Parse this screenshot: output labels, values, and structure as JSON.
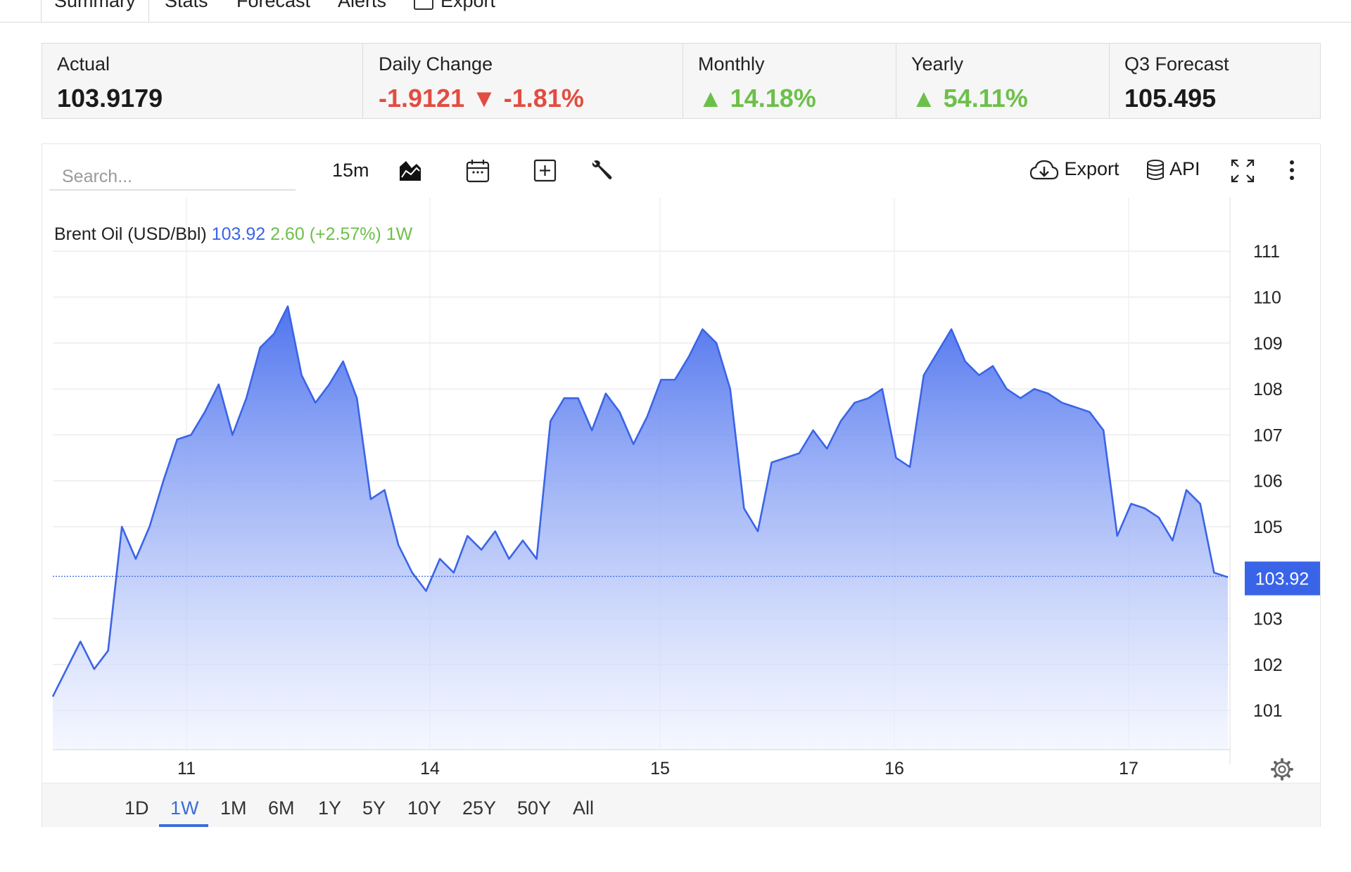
{
  "tabs": [
    {
      "label": "Summary",
      "active": true
    },
    {
      "label": "Stats"
    },
    {
      "label": "Forecast"
    },
    {
      "label": "Alerts"
    },
    {
      "label": "Export",
      "icon": "export-icon"
    }
  ],
  "stats": {
    "actual": {
      "label": "Actual",
      "value": "103.9179"
    },
    "daily": {
      "label": "Daily Change",
      "value": "-1.9121",
      "arrow": "▼",
      "pct": "-1.81%"
    },
    "monthly": {
      "label": "Monthly",
      "arrow": "▲",
      "pct": "14.18%"
    },
    "yearly": {
      "label": "Yearly",
      "arrow": "▲",
      "pct": "54.11%"
    },
    "forecast": {
      "label": "Q3 Forecast",
      "value": "105.495"
    }
  },
  "toolbar": {
    "search_placeholder": "Search...",
    "interval": "15m",
    "export_label": "Export",
    "api_label": "API"
  },
  "legend": {
    "name": "Brent Oil (USD/Bbl)",
    "last": "103.92",
    "change": "2.60 (+2.57%)",
    "period": "1W"
  },
  "price_tag": "103.92",
  "ranges": [
    {
      "label": "1D"
    },
    {
      "label": "1W",
      "active": true
    },
    {
      "label": "1M"
    },
    {
      "label": "6M"
    },
    {
      "label": "1Y"
    },
    {
      "label": "5Y"
    },
    {
      "label": "10Y"
    },
    {
      "label": "25Y"
    },
    {
      "label": "50Y"
    },
    {
      "label": "All"
    }
  ],
  "colors": {
    "line": "#3a64e8",
    "fill_top": "#4f74ee",
    "fill_bottom": "#eef2ff",
    "positive": "#6cc04a",
    "negative": "#e24c41",
    "price_tag": "#3a64e8"
  },
  "chart_data": {
    "type": "area",
    "series": [
      {
        "name": "Brent Oil (USD/Bbl)",
        "values": [
          101.3,
          101.9,
          102.5,
          101.9,
          102.3,
          105.0,
          104.3,
          105.0,
          106.0,
          106.9,
          107.0,
          107.5,
          108.1,
          107.0,
          107.8,
          108.9,
          109.2,
          109.8,
          108.3,
          107.7,
          108.1,
          108.6,
          107.8,
          105.6,
          105.8,
          104.6,
          104.0,
          103.6,
          104.3,
          104.0,
          104.8,
          104.5,
          104.9,
          104.3,
          104.7,
          104.3,
          107.3,
          107.8,
          107.8,
          107.1,
          107.9,
          107.5,
          106.8,
          107.4,
          108.2,
          108.2,
          108.7,
          109.3,
          109.0,
          108.0,
          105.4,
          104.9,
          106.4,
          106.5,
          106.6,
          107.1,
          106.7,
          107.3,
          107.7,
          107.8,
          108.0,
          106.5,
          106.3,
          108.3,
          108.8,
          109.3,
          108.6,
          108.3,
          108.5,
          108.0,
          107.8,
          108.0,
          107.9,
          107.7,
          107.6,
          107.5,
          107.1,
          104.8,
          105.5,
          105.4,
          105.2,
          104.7,
          105.8,
          105.5,
          104.0,
          103.9
        ]
      }
    ],
    "x_ticks": [
      "11",
      "14",
      "15",
      "16",
      "17"
    ],
    "y_ticks": [
      "101",
      "102",
      "103",
      "105",
      "106",
      "107",
      "108",
      "109",
      "110",
      "111"
    ],
    "ylim": [
      100,
      112
    ],
    "last_value": 103.92,
    "grid": true
  }
}
